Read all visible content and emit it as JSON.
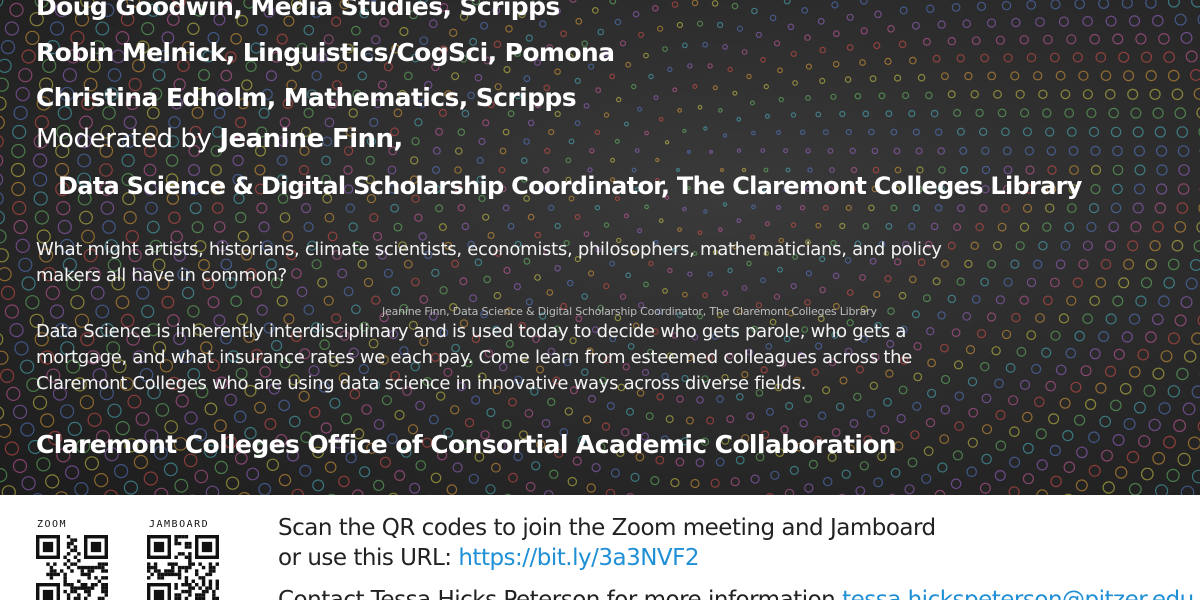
{
  "speakers": [
    "Doug Goodwin, Media Studies, Scripps",
    "Robin Melnick, Linguistics/CogSci, Pomona",
    "Christina Edholm, Mathematics, Scripps"
  ],
  "moderator": {
    "prefix": "Moderated by ",
    "name": "Jeanine Finn,",
    "role": "Data Science & Digital Scholarship Coordinator, The Claremont Colleges Library"
  },
  "question": "What might artists, historians, climate scientists, economists, philosophers, mathematicians, and policy makers all have in common?",
  "small_caption": "Jeanine Finn, Data Science & Digital Scholarship Coordinator, The Claremont Colleges Library",
  "description": {
    "lead": "Data Science",
    "rest": " is inherently interdisciplinary and is used today to decide who gets parole, who gets a mortgage, and what insurance rates we each pay. Come learn from esteemed colleagues across the Claremont Colleges who are using data science in innovative ways across diverse fields."
  },
  "office": "Claremont Colleges Office of Consortial Academic Collaboration",
  "footer": {
    "qr_labels": [
      "ZOOM",
      "JAMBOARD"
    ],
    "scan_line1": "Scan the QR codes to join the Zoom meeting and Jamboard",
    "scan_line2_prefix": "or use this URL: ",
    "url": "https://bit.ly/3a3NVF2",
    "contact_prefix": "Contact Tessa Hicks Peterson for more information ",
    "contact_email": "tessa.hickspeterson@pitzer.edu"
  },
  "colors": {
    "accent_link": "#1f8fd6",
    "background_dark": "#2a2a2a"
  }
}
